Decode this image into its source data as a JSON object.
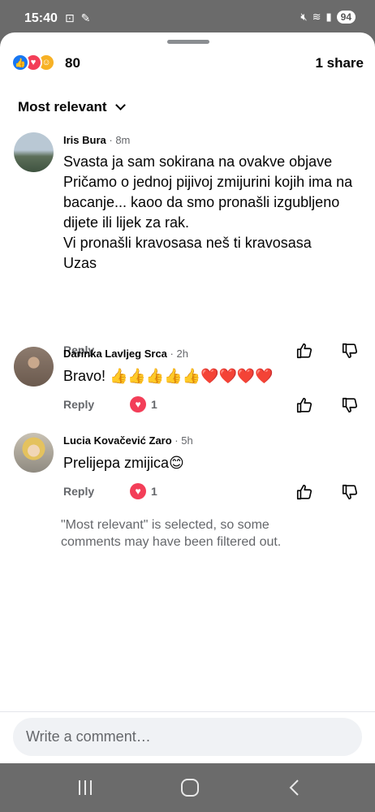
{
  "status_bar": {
    "time": "15:40",
    "battery": "94"
  },
  "reactions": {
    "count": "80",
    "shares": "1 share",
    "types": [
      "like-icon",
      "love-icon",
      "care-icon"
    ]
  },
  "sort": {
    "label": "Most relevant"
  },
  "comments": [
    {
      "author": "Iris Bura",
      "time": "· 8m",
      "text": "Svasta ja sam sokirana na ovakve objave\nPričamo o jednoj pijivoj zmijurini kojih ima na bacanje... kaoo da smo pronašli izgubljeno dijete ili lijek za rak.\nVi pronašli kravosasa neš ti kravosasa\nUzas",
      "reply_label": "Reply",
      "reaction_count": null
    },
    {
      "author": "Darinka Lavljeg Srca",
      "time": "· 2h",
      "text": "Bravo! 👍👍👍👍👍❤️❤️❤️❤️",
      "reply_label": "Reply",
      "reaction_count": "1"
    },
    {
      "author": "Lucia Kovačević Zaro",
      "time": "· 5h",
      "text": "Prelijepa zmijica😊",
      "reply_label": "Reply",
      "reaction_count": "1"
    }
  ],
  "filter_note": "\"Most relevant\" is selected, so some comments may have been filtered out.",
  "composer": {
    "placeholder": "Write a comment…"
  },
  "colors": {
    "like": "#1877f2",
    "love": "#f33e58",
    "secondary_text": "#65676b"
  }
}
